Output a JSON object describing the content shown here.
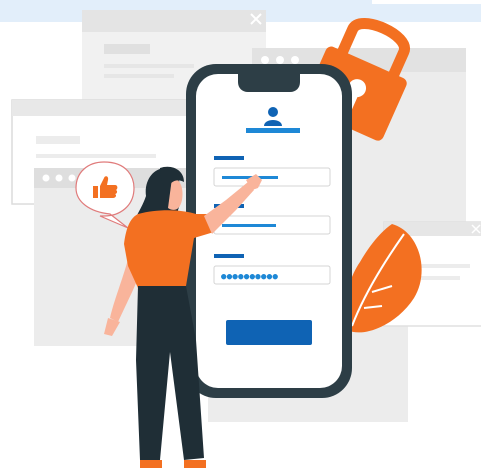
{
  "login_form": {
    "password_mask": "●●●●●●●●●●"
  },
  "colors": {
    "accent_orange": "#f37021",
    "accent_blue": "#1e88d6",
    "button_blue": "#0f63b4",
    "phone_frame": "#2d3e46",
    "window_gray": "#ececec",
    "window_bar": "#dedede",
    "top_strip": "#e2eefa"
  },
  "icons": [
    "close-icon",
    "lock-icon",
    "user-icon",
    "thumbs-up-icon",
    "leaf-decoration"
  ]
}
